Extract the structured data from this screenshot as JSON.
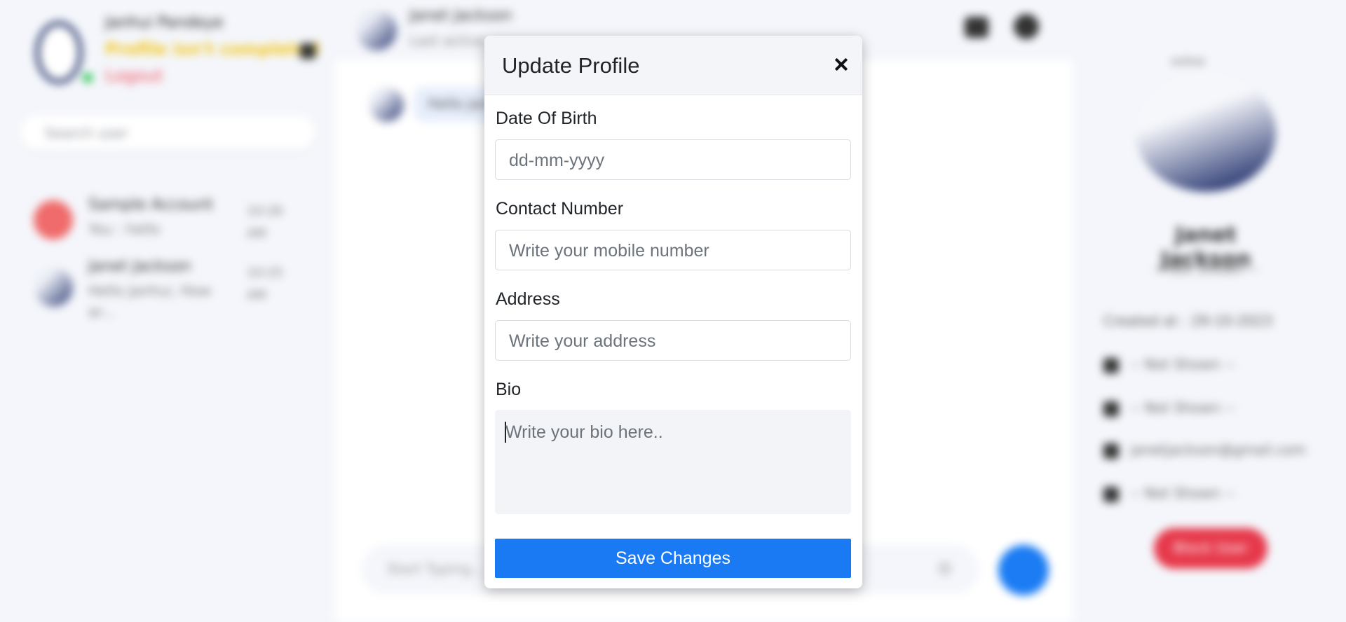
{
  "background": {
    "me": {
      "name": "Janhui Pandeye",
      "warning": "Profile isn't completed",
      "logout": "Logout"
    },
    "search": {
      "placeholder": "Search user"
    },
    "conversations": [
      {
        "name": "Sample Account",
        "message": "You : hello",
        "time": "10:26 AM"
      },
      {
        "name": "Janet Jackson",
        "message": "Hello Janhui, How ar...",
        "time": "10:25 AM"
      }
    ],
    "chat": {
      "name": "Janet Jackson",
      "status": "Last active",
      "message": "Hello Janhui",
      "composer_placeholder": "Start Typing...",
      "emoji": "😊"
    },
    "profile": {
      "online": "online",
      "name": "Janet Jackson",
      "not_shown": "-- Not Shown --",
      "created": "Created at : 29-10-2023",
      "rows": [
        "-- Not Shown --",
        "-- Not Shown --",
        "janetjackson@gmail.com",
        "-- Not Shown --"
      ],
      "block": "Block User"
    }
  },
  "modal": {
    "title": "Update Profile",
    "fields": {
      "dob": {
        "label": "Date Of Birth",
        "placeholder": "dd-mm-yyyy"
      },
      "contact": {
        "label": "Contact Number",
        "placeholder": "Write your mobile number"
      },
      "address": {
        "label": "Address",
        "placeholder": "Write your address"
      },
      "bio": {
        "label": "Bio",
        "placeholder": "Write your bio here.."
      }
    },
    "save_label": "Save Changes"
  },
  "colors": {
    "primary": "#1a7af4",
    "danger": "#e6394b",
    "warning": "#f3c516",
    "online": "#26c450"
  }
}
